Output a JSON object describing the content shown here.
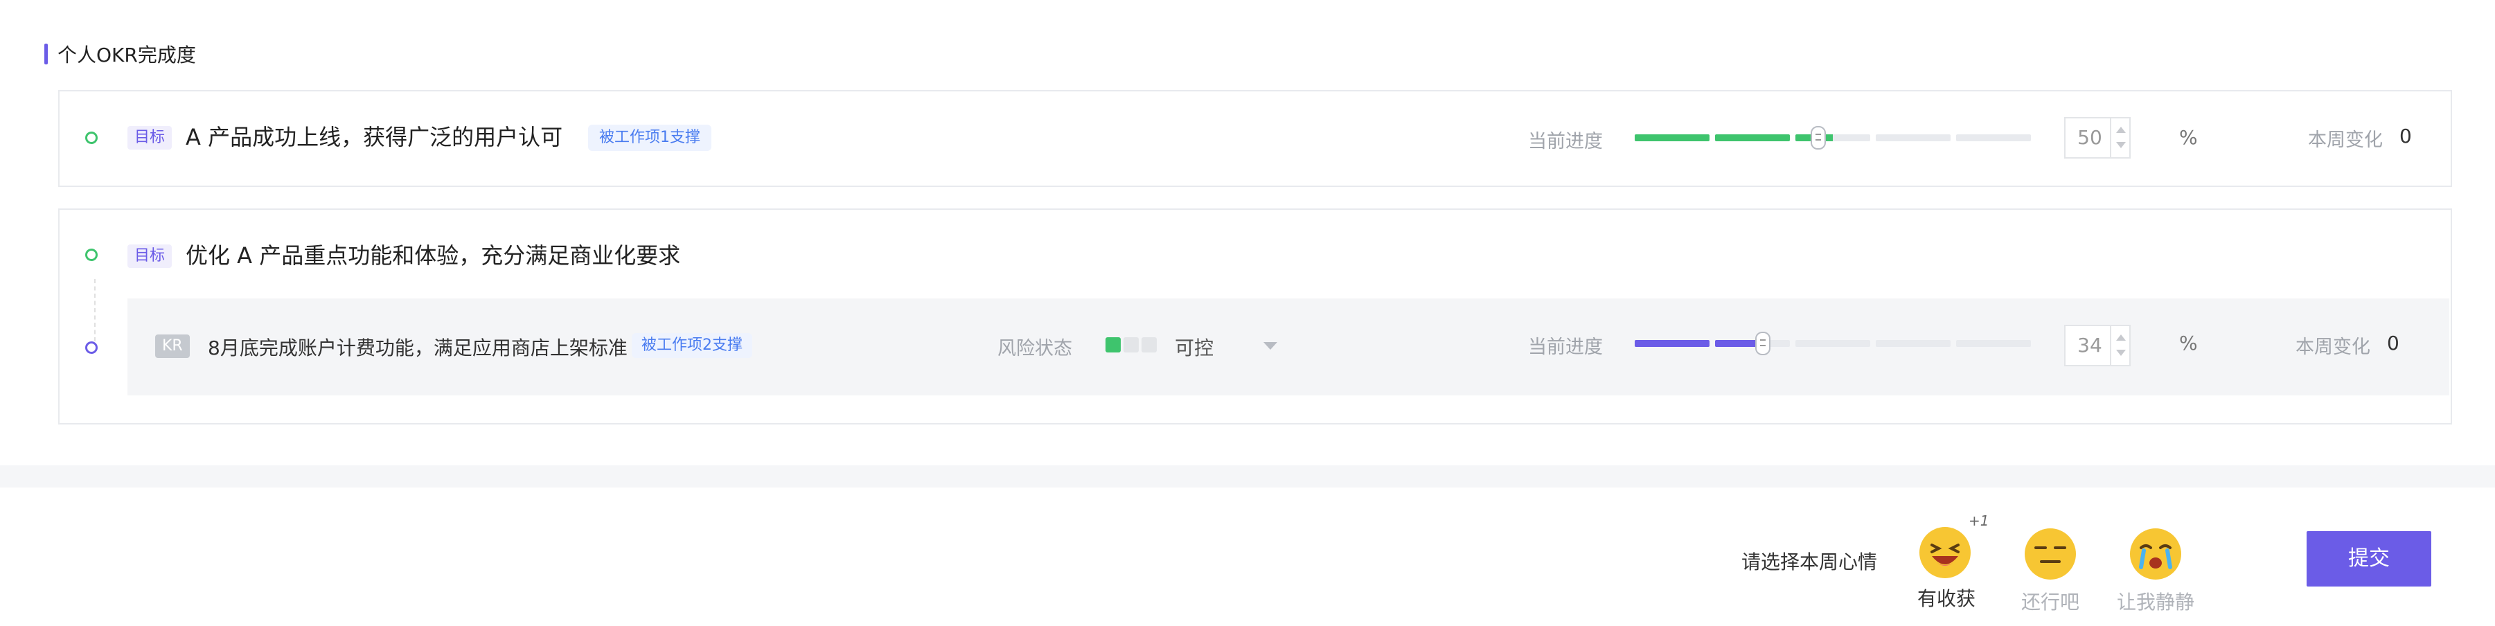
{
  "section": {
    "title": "个人OKR完成度"
  },
  "objectives": [
    {
      "tag": "目标",
      "title": "A 产品成功上线，获得广泛的用户认可",
      "support": "被工作项1支撑",
      "progress_label": "当前进度",
      "progress_value": "50",
      "progress_fraction": 0.5,
      "unit": "%",
      "week_change_label": "本周变化",
      "week_change_value": "0"
    },
    {
      "tag": "目标",
      "title": "优化 A 产品重点功能和体验，充分满足商业化要求",
      "kr": {
        "badge": "KR",
        "title": "8月底完成账户计费功能，满足应用商店上架标准",
        "support": "被工作项2支撑",
        "risk_label": "风险状态",
        "risk_value": "可控",
        "progress_label": "当前进度",
        "progress_value": "34",
        "progress_fraction": 0.34,
        "unit": "%",
        "week_change_label": "本周变化",
        "week_change_value": "0"
      }
    }
  ],
  "mood": {
    "prompt": "请选择本周心情",
    "options": [
      {
        "label": "有收获",
        "badge": "+1",
        "icon": "laughing-face-icon"
      },
      {
        "label": "还行吧",
        "icon": "neutral-face-icon"
      },
      {
        "label": "让我静静",
        "icon": "crying-face-icon"
      }
    ]
  },
  "submit_label": "提交",
  "colors": {
    "accent": "#6b5ce7",
    "progress_green": "#3ec46d",
    "risk_green": "#3ec46d",
    "link_blue": "#4a7cf0",
    "emoji_yellow": "#f7c633"
  }
}
